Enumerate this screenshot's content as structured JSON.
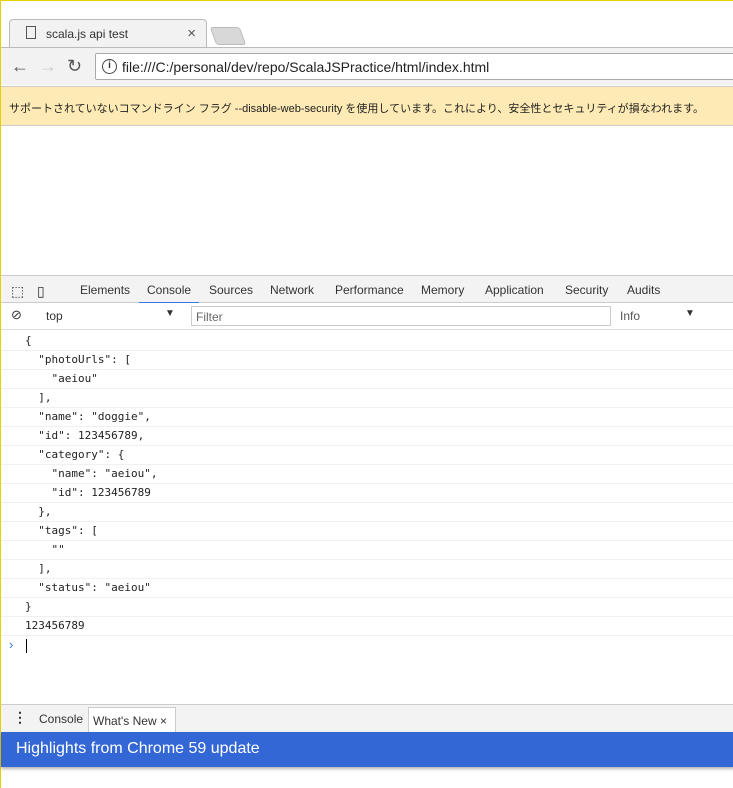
{
  "browser": {
    "tab_title": "scala.js api test",
    "url": "file:///C:/personal/dev/repo/ScalaJSPractice/html/index.html"
  },
  "infobar": {
    "message": "サポートされていないコマンドライン フラグ --disable-web-security を使用しています。これにより、安全性とセキュリティが損なわれます。"
  },
  "devtools": {
    "tabs": [
      "Elements",
      "Console",
      "Sources",
      "Network",
      "Performance",
      "Memory",
      "Application",
      "Security",
      "Audits"
    ],
    "active_tab": "Console",
    "context": "top",
    "filter_placeholder": "Filter",
    "level": "Info"
  },
  "console": {
    "lines": [
      "{",
      "  \"photoUrls\": [",
      "    \"aeiou\"",
      "  ],",
      "  \"name\": \"doggie\",",
      "  \"id\": 123456789,",
      "  \"category\": {",
      "    \"name\": \"aeiou\",",
      "    \"id\": 123456789",
      "  },",
      "  \"tags\": [",
      "    \"\"",
      "  ],",
      "  \"status\": \"aeiou\"",
      "}",
      "123456789"
    ]
  },
  "drawer": {
    "tabs": [
      "Console",
      "What's New"
    ],
    "banner": "Highlights from Chrome 59 update"
  },
  "colors": {
    "accent": "#3367d6",
    "infobar": "#feeab4"
  }
}
